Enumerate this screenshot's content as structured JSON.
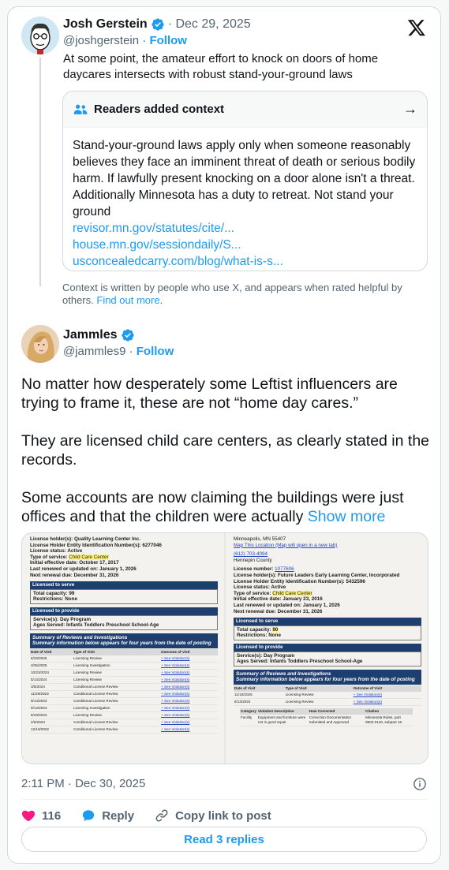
{
  "quoted": {
    "name": "Josh Gerstein",
    "date": "· Dec 29, 2025",
    "handle": "@joshgerstein",
    "separator": "·",
    "follow_label": "Follow",
    "text": "At some point, the amateur effort to knock on doors of home daycares intersects with robust stand-your-ground laws"
  },
  "context": {
    "title": "Readers added context",
    "body": "Stand-your-ground laws apply only when someone reasonably believes they face an imminent threat of death or serious bodily harm. If lawfully present knocking on a door alone isn't a threat. Additionally Minnesota has a duty to retreat. Not stand your ground",
    "links": [
      "revisor.mn.gov/statutes/cite/...",
      "house.mn.gov/sessiondaily/S...",
      "usconcealedcarry.com/blog/what-is-s..."
    ],
    "note": "Context is written by people who use X, and appears when rated helpful by others.",
    "find_out_more": "Find out more",
    "note_end": "."
  },
  "post": {
    "name": "Jammles",
    "handle": "@jammles9",
    "separator": "·",
    "follow_label": "Follow",
    "paragraphs": [
      "No matter how desperately some Leftist influencers are trying to frame it, these are not “home day cares.”",
      "They are licensed child care centers, as clearly stated in the records.",
      "Some accounts are now claiming the buildings were just offices and that the children were actually"
    ],
    "show_more": "Show more",
    "timestamp": "2:11 PM · Dec 30, 2025"
  },
  "doc_left": {
    "lines": [
      "License holder(s): Quality Learning Center Inc.",
      "License Holder Entity Identification Number(s): 6277046",
      "License status: Active",
      "Type of service:",
      "Child Care Center",
      "Initial effective date: October 17, 2017",
      "Last renewed or updated on: January 1, 2026",
      "Next renewal due: December 31, 2026"
    ],
    "licensed_to_serve": "Licensed to serve",
    "capacity": "Total capacity: 99",
    "restrictions": "Restrictions: None",
    "licensed_to_provide": "Licensed to provide",
    "services": "Service(s): Day Program",
    "ages": "Ages Served: Infants Toddlers Preschool School-Age",
    "summary_title": "Summary of Reviews and Investigations",
    "summary_sub": "Summary information below appears for four years from the date of posting",
    "table_headers": [
      "Date of Visit",
      "Type of Visit",
      "Outcome of Visit"
    ],
    "rows": [
      [
        "6/23/2025",
        "Licensing Review",
        "+ See Violation(s)"
      ],
      [
        "3/25/2025",
        "Licensing Investigation",
        "+ See Violation(s)"
      ],
      [
        "10/23/2024",
        "Licensing Review",
        "+ See Violation(s)"
      ],
      [
        "5/14/2024",
        "Licensing Review",
        "+ See Violation(s)"
      ],
      [
        "3/5/2024",
        "Conditional License Review",
        "+ See Violation(s)"
      ],
      [
        "11/28/2023",
        "Conditional License Review",
        "+ See Violation(s)"
      ],
      [
        "9/14/2023",
        "Conditional License Review",
        "+ See Violation(s)"
      ],
      [
        "9/14/2023",
        "Licensing Investigation",
        "+ See Violation(s)"
      ],
      [
        "5/23/2023",
        "Licensing Review",
        "+ See Violation(s)"
      ],
      [
        "2/6/2023",
        "Conditional License Review",
        "+ See Violation(s)"
      ],
      [
        "12/19/2022",
        "Conditional License Review",
        "+ See Violation(s)"
      ]
    ]
  },
  "doc_right": {
    "city": "Minneapolis, MN 55407",
    "map_link": "Map This Location (Map will open in a new tab)",
    "phone": "(612) 703-4094",
    "county": "Hennepin County",
    "license_number_label": "License number:",
    "license_number": "1077606",
    "holders": "License holder(s): Future Leaders Early Learning Center, Incorporated",
    "entity": "License Holder Entity Identification Number(s): 5432596",
    "status": "License status: Active",
    "type_label": "Type of service:",
    "type_value": "Child Care Center",
    "initial": "Initial effective date: January 23, 2016",
    "renewed": "Last renewed or updated on: January 1, 2026",
    "next": "Next renewal due: December 31, 2026",
    "licensed_to_serve": "Licensed to serve",
    "capacity_label": "Total capacity:",
    "capacity_value": "90",
    "restrictions": "Restrictions: None",
    "licensed_to_provide": "Licensed to provide",
    "services": "Service(s): Day Program",
    "ages": "Ages Served: Infants Toddlers Preschool School-Age",
    "summary_title": "Summary of Reviews and Investigations",
    "summary_sub": "Summary information below appears for four years from the date of posting",
    "table_headers": [
      "Date of Visit",
      "Type of Visit",
      "Outcome of Visit"
    ],
    "rows": [
      [
        "11/10/2025",
        "Licensing Review",
        "+ See Violation(s)"
      ],
      [
        "6/13/2024",
        "Licensing Review",
        "+ See Violation(s)"
      ]
    ],
    "sub_headers": [
      "Category",
      "Violation Description",
      "How Corrected",
      "Citation"
    ],
    "sub_row": [
      "Facility",
      "Equipment and furniture were not in good repair",
      "Correction Documentation Submitted and Approved",
      "Minnesota Rules, part 9503.0140, subpart 16"
    ]
  },
  "actions": {
    "likes": "116",
    "reply": "Reply",
    "copy_link": "Copy link to post",
    "read_replies": "Read 3 replies"
  },
  "colors": {
    "accent": "#1d9bf0",
    "like": "#f91880",
    "text": "#0f1419",
    "muted": "#536471"
  }
}
